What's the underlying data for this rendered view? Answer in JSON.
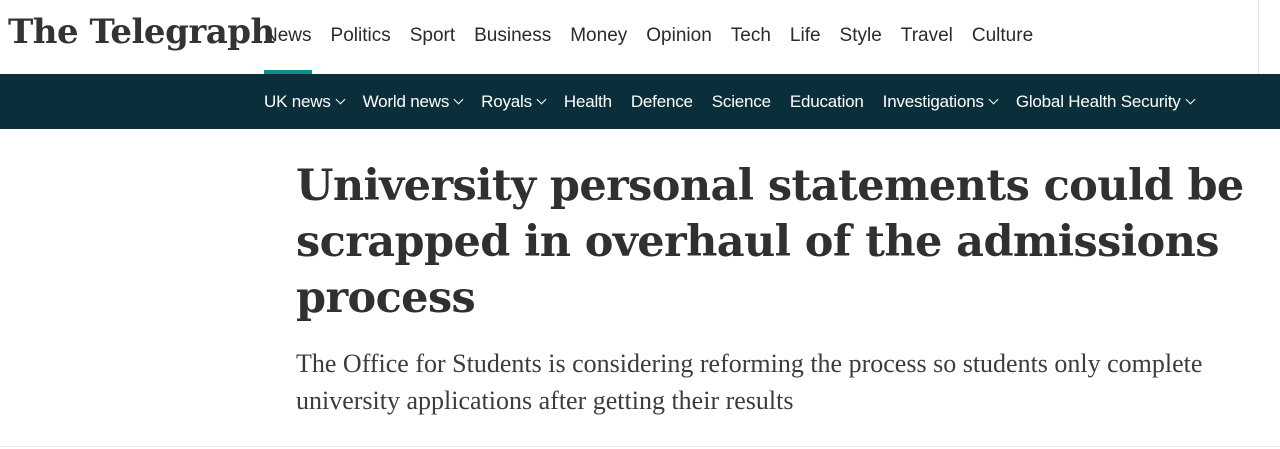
{
  "logo": {
    "text": "The Telegraph"
  },
  "primary_nav": {
    "items": [
      "News",
      "Politics",
      "Sport",
      "Business",
      "Money",
      "Opinion",
      "Tech",
      "Life",
      "Style",
      "Travel",
      "Culture"
    ],
    "active": "News",
    "accent_color": "#148b8b"
  },
  "sub_nav": {
    "background_color": "#0b2e3b",
    "items": [
      {
        "label": "UK news",
        "has_dropdown": true,
        "icon": "chevron-down-icon"
      },
      {
        "label": "World news",
        "has_dropdown": true,
        "icon": "chevron-down-icon"
      },
      {
        "label": "Royals",
        "has_dropdown": true,
        "icon": "chevron-down-icon"
      },
      {
        "label": "Health",
        "has_dropdown": false
      },
      {
        "label": "Defence",
        "has_dropdown": false
      },
      {
        "label": "Science",
        "has_dropdown": false
      },
      {
        "label": "Education",
        "has_dropdown": false
      },
      {
        "label": "Investigations",
        "has_dropdown": true,
        "icon": "chevron-down-icon"
      },
      {
        "label": "Global Health Security",
        "has_dropdown": true,
        "icon": "chevron-down-icon"
      }
    ]
  },
  "article": {
    "headline": "University personal statements could be scrapped in overhaul of the admissions process",
    "standfirst": "The Office for Students is considering reforming the process so students only complete university applications after getting their results"
  }
}
